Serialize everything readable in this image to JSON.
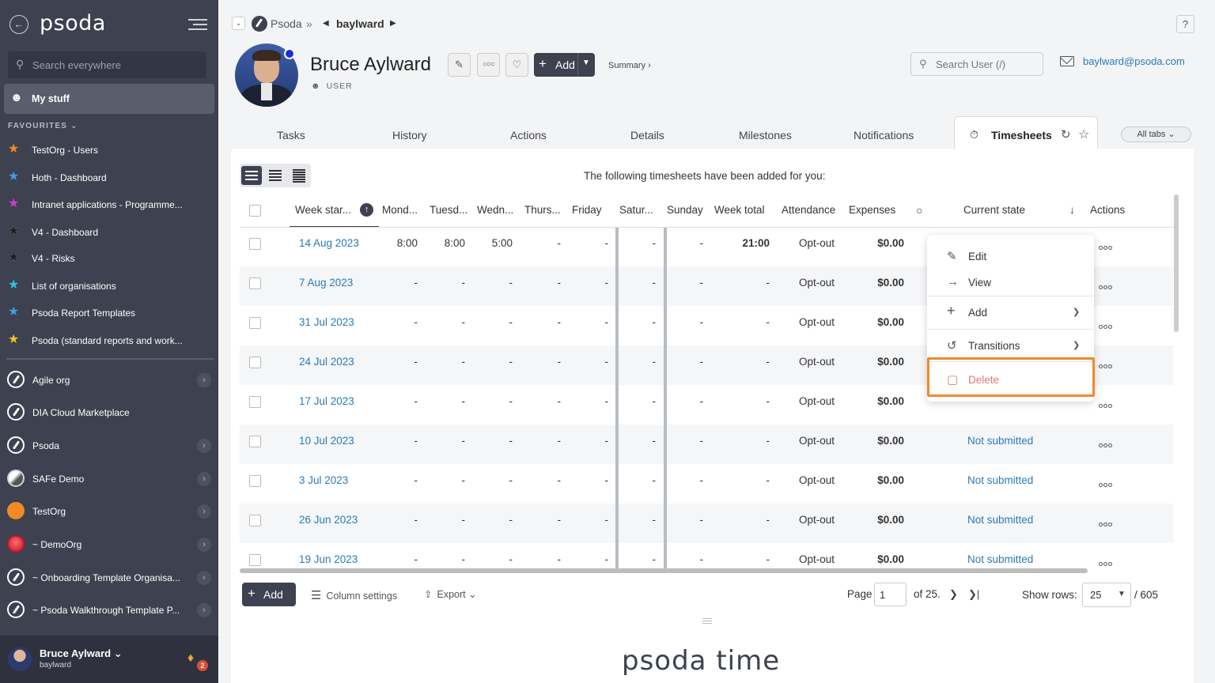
{
  "sidebar": {
    "logo": "psoda",
    "search_placeholder": "Search everywhere",
    "my_stuff": "My stuff",
    "favourites_label": "FAVOURITES",
    "favourites": [
      {
        "label": "TestOrg - Users",
        "color": "#f08a24"
      },
      {
        "label": "Hoth - Dashboard",
        "color": "#3aa0e8"
      },
      {
        "label": "Intranet applications - Programme...",
        "color": "#d63ac8"
      },
      {
        "label": "V4 - Dashboard",
        "color": "#1e1e1e"
      },
      {
        "label": "V4 - Risks",
        "color": "#1e1e1e"
      },
      {
        "label": "List of organisations",
        "color": "#2ec4d8"
      },
      {
        "label": "Psoda Report Templates",
        "color": "#3aa0e8"
      },
      {
        "label": "Psoda (standard reports and work...",
        "color": "#f2c12e"
      }
    ],
    "orgs": [
      {
        "label": "Agile org",
        "has_chevron": true
      },
      {
        "label": "DIA Cloud Marketplace",
        "has_chevron": false
      },
      {
        "label": "Psoda",
        "has_chevron": true
      },
      {
        "label": "SAFe Demo",
        "has_chevron": true
      },
      {
        "label": "TestOrg",
        "has_chevron": true
      },
      {
        "label": "~ DemoOrg",
        "has_chevron": true
      },
      {
        "label": "~ Onboarding Template Organisa...",
        "has_chevron": true
      },
      {
        "label": "~ Psoda Walkthrough Template P...",
        "has_chevron": true
      }
    ],
    "user": {
      "name": "Bruce Aylward",
      "username": "baylward",
      "notifications": "2"
    }
  },
  "breadcrumb": {
    "root": "Psoda",
    "separator": "»",
    "current": "baylward"
  },
  "header": {
    "title": "Bruce Aylward",
    "role": "USER",
    "add_label": "Add",
    "summary_label": "Summary ›",
    "search_placeholder": "Search User (/)",
    "email": "baylward@psoda.com",
    "help": "?"
  },
  "tabs": [
    "Tasks",
    "History",
    "Actions",
    "Details",
    "Milestones",
    "Notifications"
  ],
  "active_tab": "Timesheets",
  "all_tabs_label": "All tabs",
  "timesheets": {
    "caption": "The following timesheets have been added for you:",
    "columns": [
      "Week star...",
      "Mond...",
      "Tuesd...",
      "Wedn...",
      "Thurs...",
      "Friday",
      "Satur...",
      "Sunday",
      "Week total",
      "Attendance",
      "Expenses",
      "Current state",
      "Actions"
    ],
    "rows": [
      {
        "week": "14 Aug 2023",
        "mon": "8:00",
        "tue": "8:00",
        "wed": "5:00",
        "thu": "-",
        "fri": "-",
        "sat": "-",
        "sun": "-",
        "total": "21:00",
        "attendance": "Opt-out",
        "expenses": "$0.00",
        "state": ""
      },
      {
        "week": "7 Aug 2023",
        "mon": "-",
        "tue": "-",
        "wed": "-",
        "thu": "-",
        "fri": "-",
        "sat": "-",
        "sun": "-",
        "total": "-",
        "attendance": "Opt-out",
        "expenses": "$0.00",
        "state": ""
      },
      {
        "week": "31 Jul 2023",
        "mon": "-",
        "tue": "-",
        "wed": "-",
        "thu": "-",
        "fri": "-",
        "sat": "-",
        "sun": "-",
        "total": "-",
        "attendance": "Opt-out",
        "expenses": "$0.00",
        "state": ""
      },
      {
        "week": "24 Jul 2023",
        "mon": "-",
        "tue": "-",
        "wed": "-",
        "thu": "-",
        "fri": "-",
        "sat": "-",
        "sun": "-",
        "total": "-",
        "attendance": "Opt-out",
        "expenses": "$0.00",
        "state": ""
      },
      {
        "week": "17 Jul 2023",
        "mon": "-",
        "tue": "-",
        "wed": "-",
        "thu": "-",
        "fri": "-",
        "sat": "-",
        "sun": "-",
        "total": "-",
        "attendance": "Opt-out",
        "expenses": "$0.00",
        "state": ""
      },
      {
        "week": "10 Jul 2023",
        "mon": "-",
        "tue": "-",
        "wed": "-",
        "thu": "-",
        "fri": "-",
        "sat": "-",
        "sun": "-",
        "total": "-",
        "attendance": "Opt-out",
        "expenses": "$0.00",
        "state": "Not submitted"
      },
      {
        "week": "3 Jul 2023",
        "mon": "-",
        "tue": "-",
        "wed": "-",
        "thu": "-",
        "fri": "-",
        "sat": "-",
        "sun": "-",
        "total": "-",
        "attendance": "Opt-out",
        "expenses": "$0.00",
        "state": "Not submitted"
      },
      {
        "week": "26 Jun 2023",
        "mon": "-",
        "tue": "-",
        "wed": "-",
        "thu": "-",
        "fri": "-",
        "sat": "-",
        "sun": "-",
        "total": "-",
        "attendance": "Opt-out",
        "expenses": "$0.00",
        "state": "Not submitted"
      },
      {
        "week": "19 Jun 2023",
        "mon": "-",
        "tue": "-",
        "wed": "-",
        "thu": "-",
        "fri": "-",
        "sat": "-",
        "sun": "-",
        "total": "-",
        "attendance": "Opt-out",
        "expenses": "$0.00",
        "state": "Not submitted"
      }
    ]
  },
  "context_menu": {
    "edit": "Edit",
    "view": "View",
    "add": "Add",
    "transitions": "Transitions",
    "delete": "Delete"
  },
  "footer": {
    "add_label": "Add",
    "column_settings": "Column settings",
    "export": "Export",
    "page_label": "Page",
    "page_value": "1",
    "of_label": "of 25.",
    "show_rows_label": "Show rows:",
    "rows_value": "25",
    "total": "/ 605"
  },
  "brand": {
    "name": "psoda",
    "suffix": "time"
  }
}
